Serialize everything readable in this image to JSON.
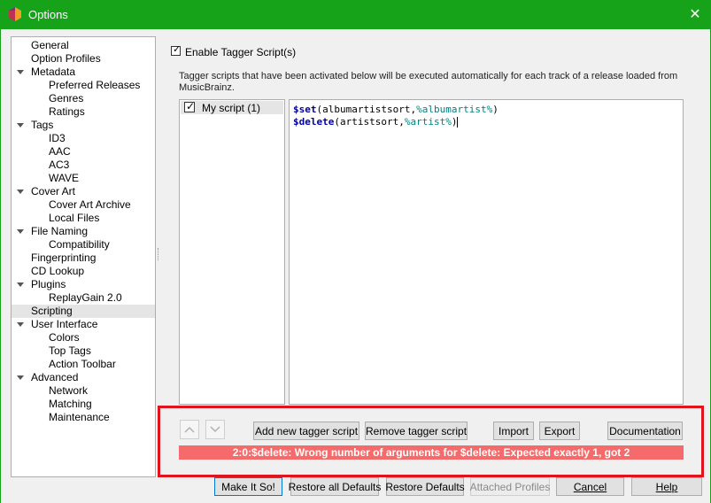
{
  "window": {
    "title": "Options"
  },
  "tree": [
    {
      "label": "General",
      "level": 0
    },
    {
      "label": "Option Profiles",
      "level": 0
    },
    {
      "label": "Metadata",
      "level": 0,
      "expanded": true
    },
    {
      "label": "Preferred Releases",
      "level": 1
    },
    {
      "label": "Genres",
      "level": 1
    },
    {
      "label": "Ratings",
      "level": 1
    },
    {
      "label": "Tags",
      "level": 0,
      "expanded": true
    },
    {
      "label": "ID3",
      "level": 1
    },
    {
      "label": "AAC",
      "level": 1
    },
    {
      "label": "AC3",
      "level": 1
    },
    {
      "label": "WAVE",
      "level": 1
    },
    {
      "label": "Cover Art",
      "level": 0,
      "expanded": true
    },
    {
      "label": "Cover Art Archive",
      "level": 1
    },
    {
      "label": "Local Files",
      "level": 1
    },
    {
      "label": "File Naming",
      "level": 0,
      "expanded": true
    },
    {
      "label": "Compatibility",
      "level": 1
    },
    {
      "label": "Fingerprinting",
      "level": 0
    },
    {
      "label": "CD Lookup",
      "level": 0
    },
    {
      "label": "Plugins",
      "level": 0,
      "expanded": true
    },
    {
      "label": "ReplayGain 2.0",
      "level": 1
    },
    {
      "label": "Scripting",
      "level": 0,
      "selected": true
    },
    {
      "label": "User Interface",
      "level": 0,
      "expanded": true
    },
    {
      "label": "Colors",
      "level": 1
    },
    {
      "label": "Top Tags",
      "level": 1
    },
    {
      "label": "Action Toolbar",
      "level": 1
    },
    {
      "label": "Advanced",
      "level": 0,
      "expanded": true
    },
    {
      "label": "Network",
      "level": 1
    },
    {
      "label": "Matching",
      "level": 1
    },
    {
      "label": "Maintenance",
      "level": 1
    }
  ],
  "scripting": {
    "enable_label": "Enable Tagger Script(s)",
    "enable_checked": true,
    "description": "Tagger scripts that have been activated below will be executed automatically for each track of a release loaded from MusicBrainz.",
    "script_name": "My script (1)",
    "script_checked": true,
    "code": {
      "line1": {
        "fn": "$set",
        "open": "(albumartistsort,",
        "var": "%albumartist%",
        "close": ")"
      },
      "line2": {
        "fn": "$delete",
        "open": "(artistsort,",
        "var": "%artist%",
        "close": ")"
      }
    },
    "buttons": {
      "add": "Add new tagger script",
      "remove": "Remove tagger script",
      "import": "Import",
      "export": "Export",
      "docs": "Documentation"
    },
    "error": "2:0:$delete: Wrong number of arguments for $delete: Expected exactly 1, got 2"
  },
  "footer": {
    "make_it_so": "Make It So!",
    "restore_all": "Restore all Defaults",
    "restore_defaults": "Restore Defaults",
    "attached_profiles": "Attached Profiles",
    "cancel": "Cancel",
    "help": "Help"
  },
  "colors": {
    "titlebar": "#16a319",
    "error_bg": "#f56a6a",
    "highlight": "#e0141c"
  }
}
